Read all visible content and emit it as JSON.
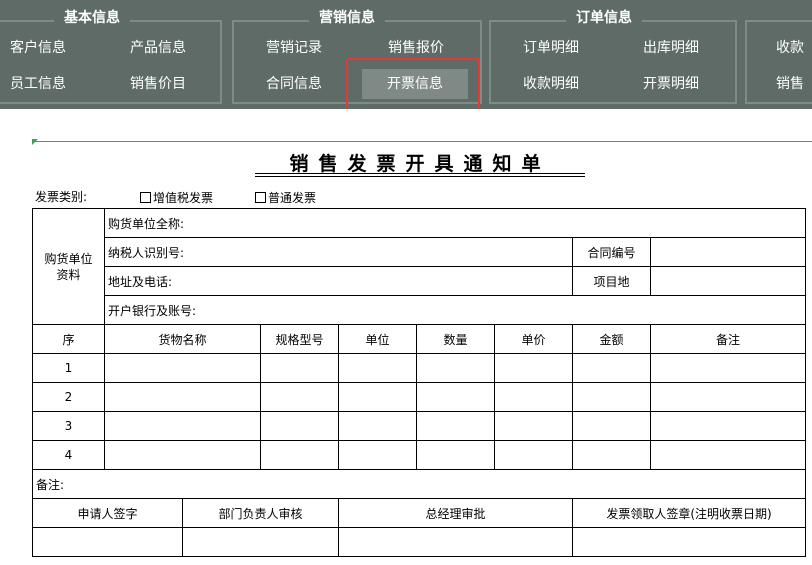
{
  "ribbon": {
    "groups": [
      {
        "title": "基本信息",
        "buttons": [
          "客户信息",
          "产品信息",
          "员工信息",
          "销售价目"
        ]
      },
      {
        "title": "营销信息",
        "buttons": [
          "营销记录",
          "销售报价",
          "合同信息",
          "开票信息"
        ]
      },
      {
        "title": "订单信息",
        "buttons": [
          "订单明细",
          "出库明细",
          "收款明细",
          "开票明细"
        ]
      },
      {
        "buttons": [
          "收款",
          "销售"
        ]
      }
    ],
    "active_button": "开票信息"
  },
  "form": {
    "title": "销售发票开具通知单",
    "invoice_type_label": "发票类别:",
    "vat_option": "增值税发票",
    "normal_option": "普通发票",
    "buyer_section_label": [
      "购货单位",
      "资料"
    ],
    "buyer_full_name": "购货单位全称:",
    "taxpayer_id": "纳税人识别号:",
    "contract_no": "合同编号",
    "address_phone": "地址及电话:",
    "project_location": "项目地",
    "bank_account": "开户银行及账号:",
    "columns": [
      "序",
      "货物名称",
      "规格型号",
      "单位",
      "数量",
      "单价",
      "金额",
      "备注"
    ],
    "rows": [
      "1",
      "2",
      "3",
      "4"
    ],
    "remarks_label": "备注:",
    "signatures": [
      "申请人签字",
      "部门负责人审核",
      "总经理审批",
      "发票领取人签章(注明收票日期)"
    ]
  },
  "colors": {
    "ribbon_bg": "#5f6b67",
    "highlight": "#e53935",
    "grid_green": "#3aa05a"
  }
}
